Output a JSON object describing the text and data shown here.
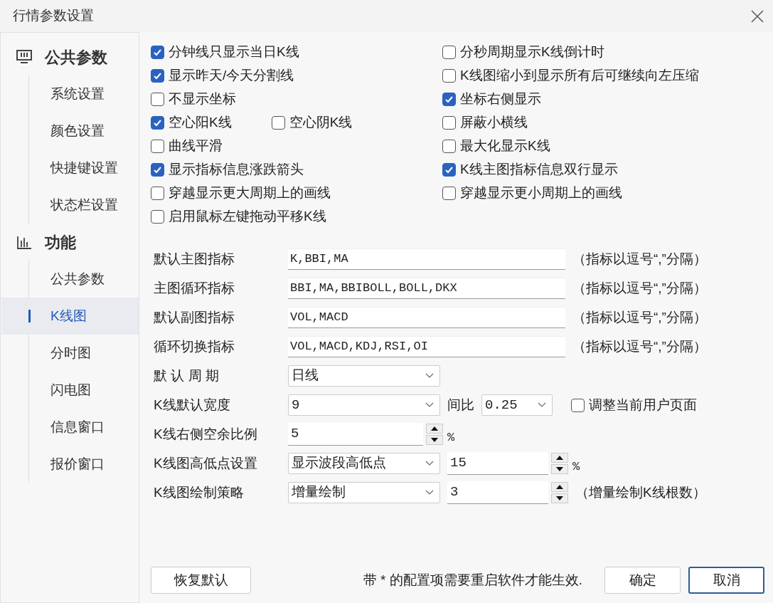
{
  "window": {
    "title": "行情参数设置"
  },
  "sidebar": {
    "groups": [
      {
        "label": "公共参数",
        "children": [
          {
            "label": "系统设置",
            "selected": false
          },
          {
            "label": "颜色设置",
            "selected": false
          },
          {
            "label": "快捷键设置",
            "selected": false
          },
          {
            "label": "状态栏设置",
            "selected": false
          }
        ]
      },
      {
        "label": "功能",
        "children": [
          {
            "label": "公共参数",
            "selected": false
          },
          {
            "label": "K线图",
            "selected": true
          },
          {
            "label": "分时图",
            "selected": false
          },
          {
            "label": "闪电图",
            "selected": false
          },
          {
            "label": "信息窗口",
            "selected": false
          },
          {
            "label": "报价窗口",
            "selected": false
          }
        ]
      }
    ]
  },
  "checkbox_rows": [
    {
      "left": [
        {
          "label": "分钟线只显示当日K线",
          "checked": true
        }
      ],
      "right": [
        {
          "label": "分秒周期显示K线倒计时",
          "checked": false
        }
      ]
    },
    {
      "left": [
        {
          "label": "显示昨天/今天分割线",
          "checked": true
        }
      ],
      "right": [
        {
          "label": "K线图缩小到显示所有后可继续向左压缩",
          "checked": false
        }
      ]
    },
    {
      "left": [
        {
          "label": "不显示坐标",
          "checked": false
        }
      ],
      "right": [
        {
          "label": "坐标右侧显示",
          "checked": true
        }
      ]
    },
    {
      "left": [
        {
          "label": "空心阳K线",
          "checked": true
        },
        {
          "label": "空心阴K线",
          "checked": false
        }
      ],
      "right": [
        {
          "label": "屏蔽小横线",
          "checked": false
        }
      ]
    },
    {
      "left": [
        {
          "label": "曲线平滑",
          "checked": false
        }
      ],
      "right": [
        {
          "label": "最大化显示K线",
          "checked": false
        }
      ]
    },
    {
      "left": [
        {
          "label": "显示指标信息涨跌箭头",
          "checked": true
        }
      ],
      "right": [
        {
          "label": "K线主图指标信息双行显示",
          "checked": true
        }
      ]
    },
    {
      "left": [
        {
          "label": "穿越显示更大周期上的画线",
          "checked": false
        }
      ],
      "right": [
        {
          "label": "穿越显示更小周期上的画线",
          "checked": false
        }
      ]
    },
    {
      "left": [
        {
          "label": "启用鼠标左键拖动平移K线",
          "checked": false
        }
      ],
      "right": []
    }
  ],
  "form_rows": [
    {
      "label": "默认主图指标",
      "controls": [
        {
          "kind": "text",
          "value": "K,BBI,MA"
        },
        {
          "kind": "note",
          "text": "（指标以逗号“,”分隔）"
        }
      ]
    },
    {
      "label": "主图循环指标",
      "controls": [
        {
          "kind": "text",
          "value": "BBI,MA,BBIBOLL,BOLL,DKX"
        },
        {
          "kind": "note",
          "text": "（指标以逗号“,”分隔）"
        }
      ]
    },
    {
      "label": "默认副图指标",
      "controls": [
        {
          "kind": "text",
          "value": "VOL,MACD"
        },
        {
          "kind": "note",
          "text": "（指标以逗号“,”分隔）"
        }
      ]
    },
    {
      "label": "循环切换指标",
      "controls": [
        {
          "kind": "text",
          "value": "VOL,MACD,KDJ,RSI,OI"
        },
        {
          "kind": "note",
          "text": "（指标以逗号“,”分隔）"
        }
      ]
    },
    {
      "label": "默 认 周 期",
      "controls": [
        {
          "kind": "select",
          "value": "日线"
        }
      ]
    },
    {
      "label": "K线默认宽度",
      "controls": [
        {
          "kind": "select",
          "value": "9"
        },
        {
          "kind": "note",
          "text": "间比"
        },
        {
          "kind": "select",
          "value": "0.25"
        },
        {
          "kind": "checkbox",
          "label": "调整当前用户页面",
          "checked": false
        }
      ]
    },
    {
      "label": "K线右侧空余比例",
      "controls": [
        {
          "kind": "spin",
          "value": "5"
        },
        {
          "kind": "unit",
          "text": "%"
        }
      ]
    },
    {
      "label": "K线图高低点设置",
      "controls": [
        {
          "kind": "select",
          "value": "显示波段高低点"
        },
        {
          "kind": "spin",
          "value": "15"
        },
        {
          "kind": "unit",
          "text": "%"
        }
      ]
    },
    {
      "label": "K线图绘制策略",
      "controls": [
        {
          "kind": "select",
          "value": "增量绘制"
        },
        {
          "kind": "spin",
          "value": "3"
        },
        {
          "kind": "note",
          "text": "（增量绘制K线根数）"
        }
      ]
    }
  ],
  "footer": {
    "reset_button": "恢复默认",
    "notice": "带 * 的配置项需要重启软件才能生效.",
    "buttons": [
      {
        "label": "确定",
        "focused": false
      },
      {
        "label": "取消",
        "focused": true
      }
    ]
  }
}
